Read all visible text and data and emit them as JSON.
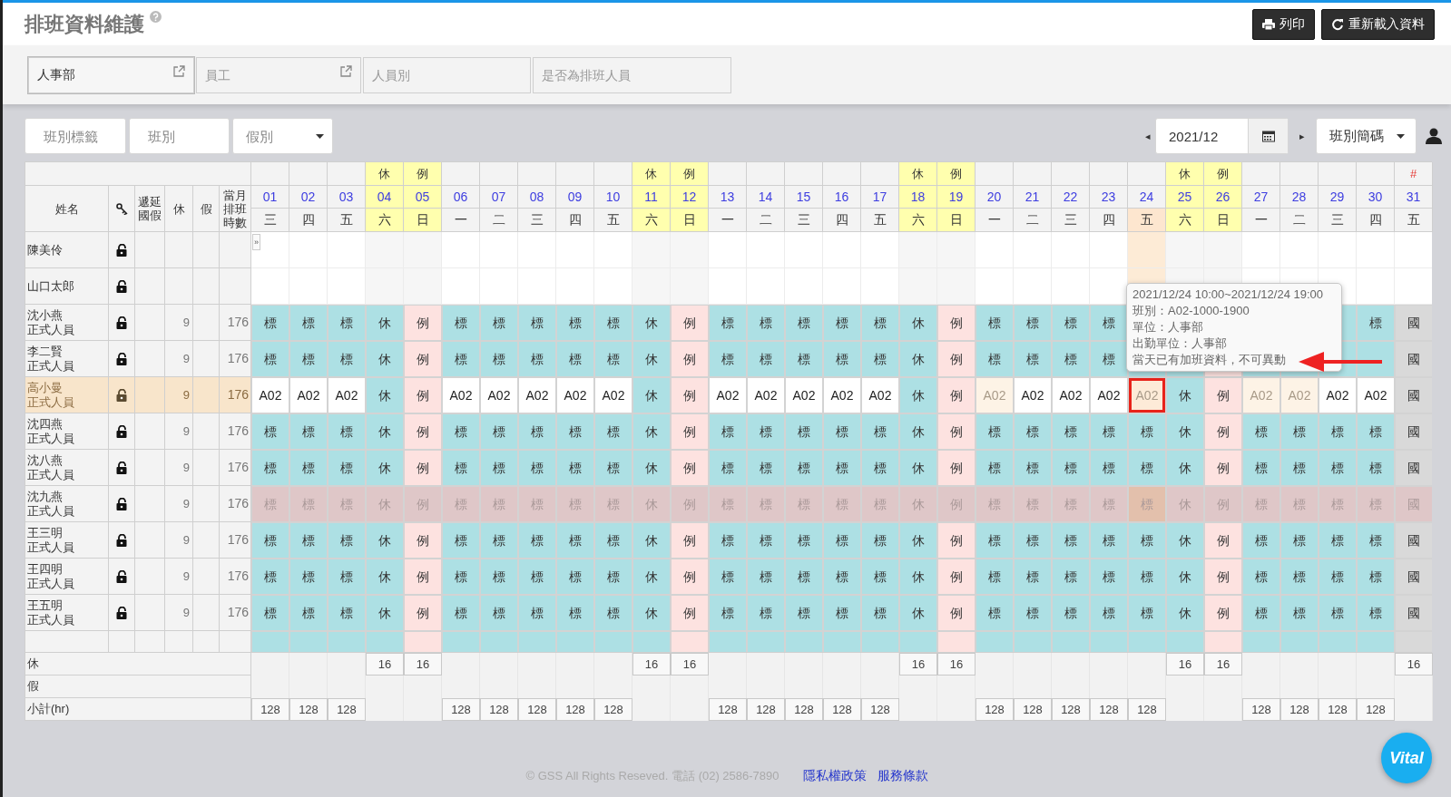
{
  "page": {
    "title": "排班資料維護",
    "buttons": [
      {
        "label": "列印",
        "kind": "print"
      },
      {
        "label": "重新載入資料",
        "kind": "reload"
      }
    ]
  },
  "filters": [
    {
      "value": "人事部",
      "link": true
    },
    {
      "placeholder": "員工",
      "link": true
    },
    {
      "placeholder": "人員別",
      "link": false
    },
    {
      "placeholder": "是否為排班人員",
      "link": false
    }
  ],
  "toolbar": {
    "fields": [
      {
        "placeholder": "班別標籤",
        "kind": "text"
      },
      {
        "placeholder": "班別",
        "kind": "text"
      },
      {
        "placeholder": "假別",
        "kind": "select"
      }
    ],
    "prev": "◂",
    "month": "2021/12",
    "next": "▸",
    "display": "班別簡碼"
  },
  "columns": [
    {
      "label": "姓名",
      "kind": "text"
    },
    {
      "kind": "icon"
    },
    {
      "label": "遞延國假",
      "kind": "text"
    },
    {
      "label": "休",
      "kind": "text"
    },
    {
      "label": "假",
      "kind": "text"
    },
    {
      "label": "當月排班時數",
      "kind": "text"
    }
  ],
  "days": [
    {
      "day": "01",
      "weekday": "三",
      "weekend": false,
      "selected": false,
      "subtotal": "128"
    },
    {
      "day": "02",
      "weekday": "四",
      "weekend": false,
      "selected": false,
      "subtotal": "128"
    },
    {
      "day": "03",
      "weekday": "五",
      "weekend": false,
      "selected": false,
      "subtotal": "128"
    },
    {
      "day": "04",
      "weekday": "六",
      "weekend": true,
      "selected": false,
      "tag": {
        "text": "休",
        "kind": "rest"
      },
      "rest_total": "16"
    },
    {
      "day": "05",
      "weekday": "日",
      "weekend": true,
      "selected": false,
      "tag": {
        "text": "例",
        "kind": "rest"
      },
      "rest_total": "16"
    },
    {
      "day": "06",
      "weekday": "一",
      "weekend": false,
      "selected": false,
      "subtotal": "128"
    },
    {
      "day": "07",
      "weekday": "二",
      "weekend": false,
      "selected": false,
      "subtotal": "128"
    },
    {
      "day": "08",
      "weekday": "三",
      "weekend": false,
      "selected": false,
      "subtotal": "128"
    },
    {
      "day": "09",
      "weekday": "四",
      "weekend": false,
      "selected": false,
      "subtotal": "128"
    },
    {
      "day": "10",
      "weekday": "五",
      "weekend": false,
      "selected": false,
      "subtotal": "128"
    },
    {
      "day": "11",
      "weekday": "六",
      "weekend": true,
      "selected": false,
      "tag": {
        "text": "休",
        "kind": "rest"
      },
      "rest_total": "16"
    },
    {
      "day": "12",
      "weekday": "日",
      "weekend": true,
      "selected": false,
      "tag": {
        "text": "例",
        "kind": "rest"
      },
      "rest_total": "16"
    },
    {
      "day": "13",
      "weekday": "一",
      "weekend": false,
      "selected": false,
      "subtotal": "128"
    },
    {
      "day": "14",
      "weekday": "二",
      "weekend": false,
      "selected": false,
      "subtotal": "128"
    },
    {
      "day": "15",
      "weekday": "三",
      "weekend": false,
      "selected": false,
      "subtotal": "128"
    },
    {
      "day": "16",
      "weekday": "四",
      "weekend": false,
      "selected": false,
      "subtotal": "128"
    },
    {
      "day": "17",
      "weekday": "五",
      "weekend": false,
      "selected": false,
      "subtotal": "128"
    },
    {
      "day": "18",
      "weekday": "六",
      "weekend": true,
      "selected": false,
      "tag": {
        "text": "休",
        "kind": "rest"
      },
      "rest_total": "16"
    },
    {
      "day": "19",
      "weekday": "日",
      "weekend": true,
      "selected": false,
      "tag": {
        "text": "例",
        "kind": "rest"
      },
      "rest_total": "16"
    },
    {
      "day": "20",
      "weekday": "一",
      "weekend": false,
      "selected": false,
      "subtotal": "128"
    },
    {
      "day": "21",
      "weekday": "二",
      "weekend": false,
      "selected": false,
      "subtotal": "128"
    },
    {
      "day": "22",
      "weekday": "三",
      "weekend": false,
      "selected": false,
      "subtotal": "128"
    },
    {
      "day": "23",
      "weekday": "四",
      "weekend": false,
      "selected": false,
      "subtotal": "128"
    },
    {
      "day": "24",
      "weekday": "五",
      "weekend": false,
      "selected": true,
      "subtotal": "128"
    },
    {
      "day": "25",
      "weekday": "六",
      "weekend": true,
      "selected": false,
      "tag": {
        "text": "休",
        "kind": "rest"
      },
      "rest_total": "16"
    },
    {
      "day": "26",
      "weekday": "日",
      "weekend": true,
      "selected": false,
      "tag": {
        "text": "例",
        "kind": "rest"
      },
      "rest_total": "16"
    },
    {
      "day": "27",
      "weekday": "一",
      "weekend": false,
      "selected": false,
      "subtotal": "128"
    },
    {
      "day": "28",
      "weekday": "二",
      "weekend": false,
      "selected": false,
      "subtotal": "128"
    },
    {
      "day": "29",
      "weekday": "三",
      "weekend": false,
      "selected": false,
      "subtotal": "128"
    },
    {
      "day": "30",
      "weekday": "四",
      "weekend": false,
      "selected": false,
      "subtotal": "128"
    },
    {
      "day": "31",
      "weekday": "五",
      "weekend": false,
      "selected": false,
      "tag": {
        "text": "#",
        "kind": "holiday"
      },
      "rest_total": "16"
    }
  ],
  "rows": [
    {
      "name": "陳美伶",
      "selected": false,
      "disabled": false,
      "expand": "»"
    },
    {
      "name": "山口太郎",
      "selected": false,
      "disabled": false
    },
    {
      "name": "沈小燕",
      "type": "正式人員",
      "rest": "9",
      "hours": "176",
      "selected": false,
      "disabled": false,
      "cells": [
        {
          "text": "標",
          "kind": "std"
        },
        {
          "text": "標",
          "kind": "std"
        },
        {
          "text": "標",
          "kind": "std"
        },
        {
          "text": "休",
          "kind": "rest"
        },
        {
          "text": "例",
          "kind": "off"
        },
        {
          "text": "標",
          "kind": "std"
        },
        {
          "text": "標",
          "kind": "std"
        },
        {
          "text": "標",
          "kind": "std"
        },
        {
          "text": "標",
          "kind": "std"
        },
        {
          "text": "標",
          "kind": "std"
        },
        {
          "text": "休",
          "kind": "rest"
        },
        {
          "text": "例",
          "kind": "off"
        },
        {
          "text": "標",
          "kind": "std"
        },
        {
          "text": "標",
          "kind": "std"
        },
        {
          "text": "標",
          "kind": "std"
        },
        {
          "text": "標",
          "kind": "std"
        },
        {
          "text": "標",
          "kind": "std"
        },
        {
          "text": "休",
          "kind": "rest"
        },
        {
          "text": "例",
          "kind": "off"
        },
        {
          "text": "標",
          "kind": "std"
        },
        {
          "text": "標",
          "kind": "std"
        },
        {
          "text": "標",
          "kind": "std"
        },
        {
          "text": "標",
          "kind": "std"
        },
        {
          "kind": "std"
        },
        {
          "kind": "rest"
        },
        {
          "kind": "off"
        },
        {
          "kind": "std"
        },
        {
          "kind": "std"
        },
        {
          "kind": "std"
        },
        {
          "text": "標",
          "kind": "std"
        },
        {
          "text": "國",
          "kind": "holiday"
        }
      ]
    },
    {
      "name": "李二賢",
      "type": "正式人員",
      "rest": "9",
      "hours": "176",
      "selected": false,
      "disabled": false,
      "cells": [
        {
          "text": "標",
          "kind": "std"
        },
        {
          "text": "標",
          "kind": "std"
        },
        {
          "text": "標",
          "kind": "std"
        },
        {
          "text": "休",
          "kind": "rest"
        },
        {
          "text": "例",
          "kind": "off"
        },
        {
          "text": "標",
          "kind": "std"
        },
        {
          "text": "標",
          "kind": "std"
        },
        {
          "text": "標",
          "kind": "std"
        },
        {
          "text": "標",
          "kind": "std"
        },
        {
          "text": "標",
          "kind": "std"
        },
        {
          "text": "休",
          "kind": "rest"
        },
        {
          "text": "例",
          "kind": "off"
        },
        {
          "text": "標",
          "kind": "std"
        },
        {
          "text": "標",
          "kind": "std"
        },
        {
          "text": "標",
          "kind": "std"
        },
        {
          "text": "標",
          "kind": "std"
        },
        {
          "text": "標",
          "kind": "std"
        },
        {
          "text": "休",
          "kind": "rest"
        },
        {
          "text": "例",
          "kind": "off"
        },
        {
          "text": "標",
          "kind": "std"
        },
        {
          "text": "標",
          "kind": "std"
        },
        {
          "text": "標",
          "kind": "std"
        },
        {
          "text": "標",
          "kind": "std"
        },
        {
          "kind": "std"
        },
        {
          "kind": "rest"
        },
        {
          "kind": "off"
        },
        {
          "kind": "std"
        },
        {
          "kind": "std"
        },
        {
          "kind": "std"
        },
        {
          "kind": "std"
        },
        {
          "text": "國",
          "kind": "holiday"
        }
      ]
    },
    {
      "name": "高小曼",
      "type": "正式人員",
      "rest": "9",
      "hours": "176",
      "selected": true,
      "disabled": false,
      "cells": [
        {
          "text": "A02",
          "kind": "shift"
        },
        {
          "text": "A02",
          "kind": "shift"
        },
        {
          "text": "A02",
          "kind": "shift"
        },
        {
          "text": "休",
          "kind": "rest"
        },
        {
          "text": "例",
          "kind": "off"
        },
        {
          "text": "A02",
          "kind": "shift"
        },
        {
          "text": "A02",
          "kind": "shift"
        },
        {
          "text": "A02",
          "kind": "shift"
        },
        {
          "text": "A02",
          "kind": "shift"
        },
        {
          "text": "A02",
          "kind": "shift"
        },
        {
          "text": "休",
          "kind": "rest"
        },
        {
          "text": "例",
          "kind": "off"
        },
        {
          "text": "A02",
          "kind": "shift"
        },
        {
          "text": "A02",
          "kind": "shift"
        },
        {
          "text": "A02",
          "kind": "shift"
        },
        {
          "text": "A02",
          "kind": "shift"
        },
        {
          "text": "A02",
          "kind": "shift"
        },
        {
          "text": "休",
          "kind": "rest"
        },
        {
          "text": "例",
          "kind": "off"
        },
        {
          "text": "A02",
          "kind": "pending"
        },
        {
          "text": "A02",
          "kind": "shift"
        },
        {
          "text": "A02",
          "kind": "shift"
        },
        {
          "text": "A02",
          "kind": "shift"
        },
        {
          "text": "A02",
          "kind": "selected"
        },
        {
          "text": "休",
          "kind": "rest"
        },
        {
          "text": "例",
          "kind": "off"
        },
        {
          "text": "A02",
          "kind": "pending"
        },
        {
          "text": "A02",
          "kind": "pending"
        },
        {
          "text": "A02",
          "kind": "shift"
        },
        {
          "text": "A02",
          "kind": "shift"
        },
        {
          "text": "國",
          "kind": "holiday"
        }
      ]
    },
    {
      "name": "沈四燕",
      "type": "正式人員",
      "rest": "9",
      "hours": "176",
      "selected": false,
      "disabled": false,
      "cells": [
        {
          "text": "標",
          "kind": "std"
        },
        {
          "text": "標",
          "kind": "std"
        },
        {
          "text": "標",
          "kind": "std"
        },
        {
          "text": "休",
          "kind": "rest"
        },
        {
          "text": "例",
          "kind": "off"
        },
        {
          "text": "標",
          "kind": "std"
        },
        {
          "text": "標",
          "kind": "std"
        },
        {
          "text": "標",
          "kind": "std"
        },
        {
          "text": "標",
          "kind": "std"
        },
        {
          "text": "標",
          "kind": "std"
        },
        {
          "text": "休",
          "kind": "rest"
        },
        {
          "text": "例",
          "kind": "off"
        },
        {
          "text": "標",
          "kind": "std"
        },
        {
          "text": "標",
          "kind": "std"
        },
        {
          "text": "標",
          "kind": "std"
        },
        {
          "text": "標",
          "kind": "std"
        },
        {
          "text": "標",
          "kind": "std"
        },
        {
          "text": "休",
          "kind": "rest"
        },
        {
          "text": "例",
          "kind": "off"
        },
        {
          "text": "標",
          "kind": "std"
        },
        {
          "text": "標",
          "kind": "std"
        },
        {
          "text": "標",
          "kind": "std"
        },
        {
          "text": "標",
          "kind": "std"
        },
        {
          "text": "標",
          "kind": "std"
        },
        {
          "text": "休",
          "kind": "rest"
        },
        {
          "text": "例",
          "kind": "off"
        },
        {
          "text": "標",
          "kind": "std"
        },
        {
          "text": "標",
          "kind": "std"
        },
        {
          "text": "標",
          "kind": "std"
        },
        {
          "text": "標",
          "kind": "std"
        },
        {
          "text": "國",
          "kind": "holiday"
        }
      ]
    },
    {
      "name": "沈八燕",
      "type": "正式人員",
      "rest": "9",
      "hours": "176",
      "selected": false,
      "disabled": false,
      "cells": [
        {
          "text": "標",
          "kind": "std"
        },
        {
          "text": "標",
          "kind": "std"
        },
        {
          "text": "標",
          "kind": "std"
        },
        {
          "text": "休",
          "kind": "rest"
        },
        {
          "text": "例",
          "kind": "off"
        },
        {
          "text": "標",
          "kind": "std"
        },
        {
          "text": "標",
          "kind": "std"
        },
        {
          "text": "標",
          "kind": "std"
        },
        {
          "text": "標",
          "kind": "std"
        },
        {
          "text": "標",
          "kind": "std"
        },
        {
          "text": "休",
          "kind": "rest"
        },
        {
          "text": "例",
          "kind": "off"
        },
        {
          "text": "標",
          "kind": "std"
        },
        {
          "text": "標",
          "kind": "std"
        },
        {
          "text": "標",
          "kind": "std"
        },
        {
          "text": "標",
          "kind": "std"
        },
        {
          "text": "標",
          "kind": "std"
        },
        {
          "text": "休",
          "kind": "rest"
        },
        {
          "text": "例",
          "kind": "off"
        },
        {
          "text": "標",
          "kind": "std"
        },
        {
          "text": "標",
          "kind": "std"
        },
        {
          "text": "標",
          "kind": "std"
        },
        {
          "text": "標",
          "kind": "std"
        },
        {
          "text": "標",
          "kind": "std"
        },
        {
          "text": "休",
          "kind": "rest"
        },
        {
          "text": "例",
          "kind": "off"
        },
        {
          "text": "標",
          "kind": "std"
        },
        {
          "text": "標",
          "kind": "std"
        },
        {
          "text": "標",
          "kind": "std"
        },
        {
          "text": "標",
          "kind": "std"
        },
        {
          "text": "國",
          "kind": "holiday"
        }
      ]
    },
    {
      "name": "沈九燕",
      "type": "正式人員",
      "rest": "9",
      "hours": "176",
      "selected": false,
      "disabled": true,
      "cells": [
        {
          "text": "標",
          "kind": "std"
        },
        {
          "text": "標",
          "kind": "std"
        },
        {
          "text": "標",
          "kind": "std"
        },
        {
          "text": "休",
          "kind": "rest"
        },
        {
          "text": "例",
          "kind": "off"
        },
        {
          "text": "標",
          "kind": "std"
        },
        {
          "text": "標",
          "kind": "std"
        },
        {
          "text": "標",
          "kind": "std"
        },
        {
          "text": "標",
          "kind": "std"
        },
        {
          "text": "標",
          "kind": "std"
        },
        {
          "text": "休",
          "kind": "rest"
        },
        {
          "text": "例",
          "kind": "off"
        },
        {
          "text": "標",
          "kind": "std"
        },
        {
          "text": "標",
          "kind": "std"
        },
        {
          "text": "標",
          "kind": "std"
        },
        {
          "text": "標",
          "kind": "std"
        },
        {
          "text": "標",
          "kind": "std"
        },
        {
          "text": "休",
          "kind": "rest"
        },
        {
          "text": "例",
          "kind": "off"
        },
        {
          "text": "標",
          "kind": "std"
        },
        {
          "text": "標",
          "kind": "std"
        },
        {
          "text": "標",
          "kind": "std"
        },
        {
          "text": "標",
          "kind": "std"
        },
        {
          "text": "標",
          "kind": "std"
        },
        {
          "text": "休",
          "kind": "rest"
        },
        {
          "text": "例",
          "kind": "off"
        },
        {
          "text": "標",
          "kind": "std"
        },
        {
          "text": "標",
          "kind": "std"
        },
        {
          "text": "標",
          "kind": "std"
        },
        {
          "text": "標",
          "kind": "std"
        },
        {
          "text": "國",
          "kind": "holiday"
        }
      ]
    },
    {
      "name": "王三明",
      "type": "正式人員",
      "rest": "9",
      "hours": "176",
      "selected": false,
      "disabled": false,
      "cells": [
        {
          "text": "標",
          "kind": "std"
        },
        {
          "text": "標",
          "kind": "std"
        },
        {
          "text": "標",
          "kind": "std"
        },
        {
          "text": "休",
          "kind": "rest"
        },
        {
          "text": "例",
          "kind": "off"
        },
        {
          "text": "標",
          "kind": "std"
        },
        {
          "text": "標",
          "kind": "std"
        },
        {
          "text": "標",
          "kind": "std"
        },
        {
          "text": "標",
          "kind": "std"
        },
        {
          "text": "標",
          "kind": "std"
        },
        {
          "text": "休",
          "kind": "rest"
        },
        {
          "text": "例",
          "kind": "off"
        },
        {
          "text": "標",
          "kind": "std"
        },
        {
          "text": "標",
          "kind": "std"
        },
        {
          "text": "標",
          "kind": "std"
        },
        {
          "text": "標",
          "kind": "std"
        },
        {
          "text": "標",
          "kind": "std"
        },
        {
          "text": "休",
          "kind": "rest"
        },
        {
          "text": "例",
          "kind": "off"
        },
        {
          "text": "標",
          "kind": "std"
        },
        {
          "text": "標",
          "kind": "std"
        },
        {
          "text": "標",
          "kind": "std"
        },
        {
          "text": "標",
          "kind": "std"
        },
        {
          "text": "標",
          "kind": "std"
        },
        {
          "text": "休",
          "kind": "rest"
        },
        {
          "text": "例",
          "kind": "off"
        },
        {
          "text": "標",
          "kind": "std"
        },
        {
          "text": "標",
          "kind": "std"
        },
        {
          "text": "標",
          "kind": "std"
        },
        {
          "text": "標",
          "kind": "std"
        },
        {
          "text": "國",
          "kind": "holiday"
        }
      ]
    },
    {
      "name": "王四明",
      "type": "正式人員",
      "rest": "9",
      "hours": "176",
      "selected": false,
      "disabled": false,
      "cells": [
        {
          "text": "標",
          "kind": "std"
        },
        {
          "text": "標",
          "kind": "std"
        },
        {
          "text": "標",
          "kind": "std"
        },
        {
          "text": "休",
          "kind": "rest"
        },
        {
          "text": "例",
          "kind": "off"
        },
        {
          "text": "標",
          "kind": "std"
        },
        {
          "text": "標",
          "kind": "std"
        },
        {
          "text": "標",
          "kind": "std"
        },
        {
          "text": "標",
          "kind": "std"
        },
        {
          "text": "標",
          "kind": "std"
        },
        {
          "text": "休",
          "kind": "rest"
        },
        {
          "text": "例",
          "kind": "off"
        },
        {
          "text": "標",
          "kind": "std"
        },
        {
          "text": "標",
          "kind": "std"
        },
        {
          "text": "標",
          "kind": "std"
        },
        {
          "text": "標",
          "kind": "std"
        },
        {
          "text": "標",
          "kind": "std"
        },
        {
          "text": "休",
          "kind": "rest"
        },
        {
          "text": "例",
          "kind": "off"
        },
        {
          "text": "標",
          "kind": "std"
        },
        {
          "text": "標",
          "kind": "std"
        },
        {
          "text": "標",
          "kind": "std"
        },
        {
          "text": "標",
          "kind": "std"
        },
        {
          "text": "標",
          "kind": "std"
        },
        {
          "text": "休",
          "kind": "rest"
        },
        {
          "text": "例",
          "kind": "off"
        },
        {
          "text": "標",
          "kind": "std"
        },
        {
          "text": "標",
          "kind": "std"
        },
        {
          "text": "標",
          "kind": "std"
        },
        {
          "text": "標",
          "kind": "std"
        },
        {
          "text": "國",
          "kind": "holiday"
        }
      ]
    },
    {
      "name": "王五明",
      "type": "正式人員",
      "rest": "9",
      "hours": "176",
      "selected": false,
      "disabled": false,
      "cells": [
        {
          "text": "標",
          "kind": "std"
        },
        {
          "text": "標",
          "kind": "std"
        },
        {
          "text": "標",
          "kind": "std"
        },
        {
          "text": "休",
          "kind": "rest"
        },
        {
          "text": "例",
          "kind": "off"
        },
        {
          "text": "標",
          "kind": "std"
        },
        {
          "text": "標",
          "kind": "std"
        },
        {
          "text": "標",
          "kind": "std"
        },
        {
          "text": "標",
          "kind": "std"
        },
        {
          "text": "標",
          "kind": "std"
        },
        {
          "text": "休",
          "kind": "rest"
        },
        {
          "text": "例",
          "kind": "off"
        },
        {
          "text": "標",
          "kind": "std"
        },
        {
          "text": "標",
          "kind": "std"
        },
        {
          "text": "標",
          "kind": "std"
        },
        {
          "text": "標",
          "kind": "std"
        },
        {
          "text": "標",
          "kind": "std"
        },
        {
          "text": "休",
          "kind": "rest"
        },
        {
          "text": "例",
          "kind": "off"
        },
        {
          "text": "標",
          "kind": "std"
        },
        {
          "text": "標",
          "kind": "std"
        },
        {
          "text": "標",
          "kind": "std"
        },
        {
          "text": "標",
          "kind": "std"
        },
        {
          "text": "標",
          "kind": "std"
        },
        {
          "text": "休",
          "kind": "rest"
        },
        {
          "text": "例",
          "kind": "off"
        },
        {
          "text": "標",
          "kind": "std"
        },
        {
          "text": "標",
          "kind": "std"
        },
        {
          "text": "標",
          "kind": "std"
        },
        {
          "text": "標",
          "kind": "std"
        },
        {
          "text": "國",
          "kind": "holiday"
        }
      ]
    },
    {
      "selected": false,
      "disabled": false,
      "cells": [
        {
          "kind": "std"
        },
        {
          "kind": "std"
        },
        {
          "kind": "std"
        },
        {
          "kind": "rest"
        },
        {
          "kind": "off"
        },
        {
          "kind": "std"
        },
        {
          "kind": "std"
        },
        {
          "kind": "std"
        },
        {
          "kind": "std"
        },
        {
          "kind": "std"
        },
        {
          "kind": "rest"
        },
        {
          "kind": "off"
        },
        {
          "kind": "std"
        },
        {
          "kind": "std"
        },
        {
          "kind": "std"
        },
        {
          "kind": "std"
        },
        {
          "kind": "std"
        },
        {
          "kind": "rest"
        },
        {
          "kind": "off"
        },
        {
          "kind": "std"
        },
        {
          "kind": "std"
        },
        {
          "kind": "std"
        },
        {
          "kind": "std"
        },
        {
          "kind": "std"
        },
        {
          "kind": "rest"
        },
        {
          "kind": "off"
        },
        {
          "kind": "std"
        },
        {
          "kind": "std"
        },
        {
          "kind": "std"
        },
        {
          "kind": "std"
        },
        {
          "kind": "holiday"
        }
      ]
    }
  ],
  "summary": [
    {
      "label": "休",
      "kind": "rest_total"
    },
    {
      "label": "假",
      "kind": "leave"
    },
    {
      "label": "小計(hr)",
      "kind": "subtotal"
    }
  ],
  "tooltip": {
    "lines": [
      "2021/12/24 10:00~2021/12/24 19:00",
      "班別：A02-1000-1900",
      "單位：人事部",
      "出勤單位：人事部",
      "當天已有加班資料，不可異動"
    ]
  },
  "footer": {
    "copyright": "© GSS All Rights Reseved. 電話 (02) 2586-7890",
    "links": [
      "隱私權政策",
      "服務條款"
    ]
  },
  "badge": "Vital"
}
